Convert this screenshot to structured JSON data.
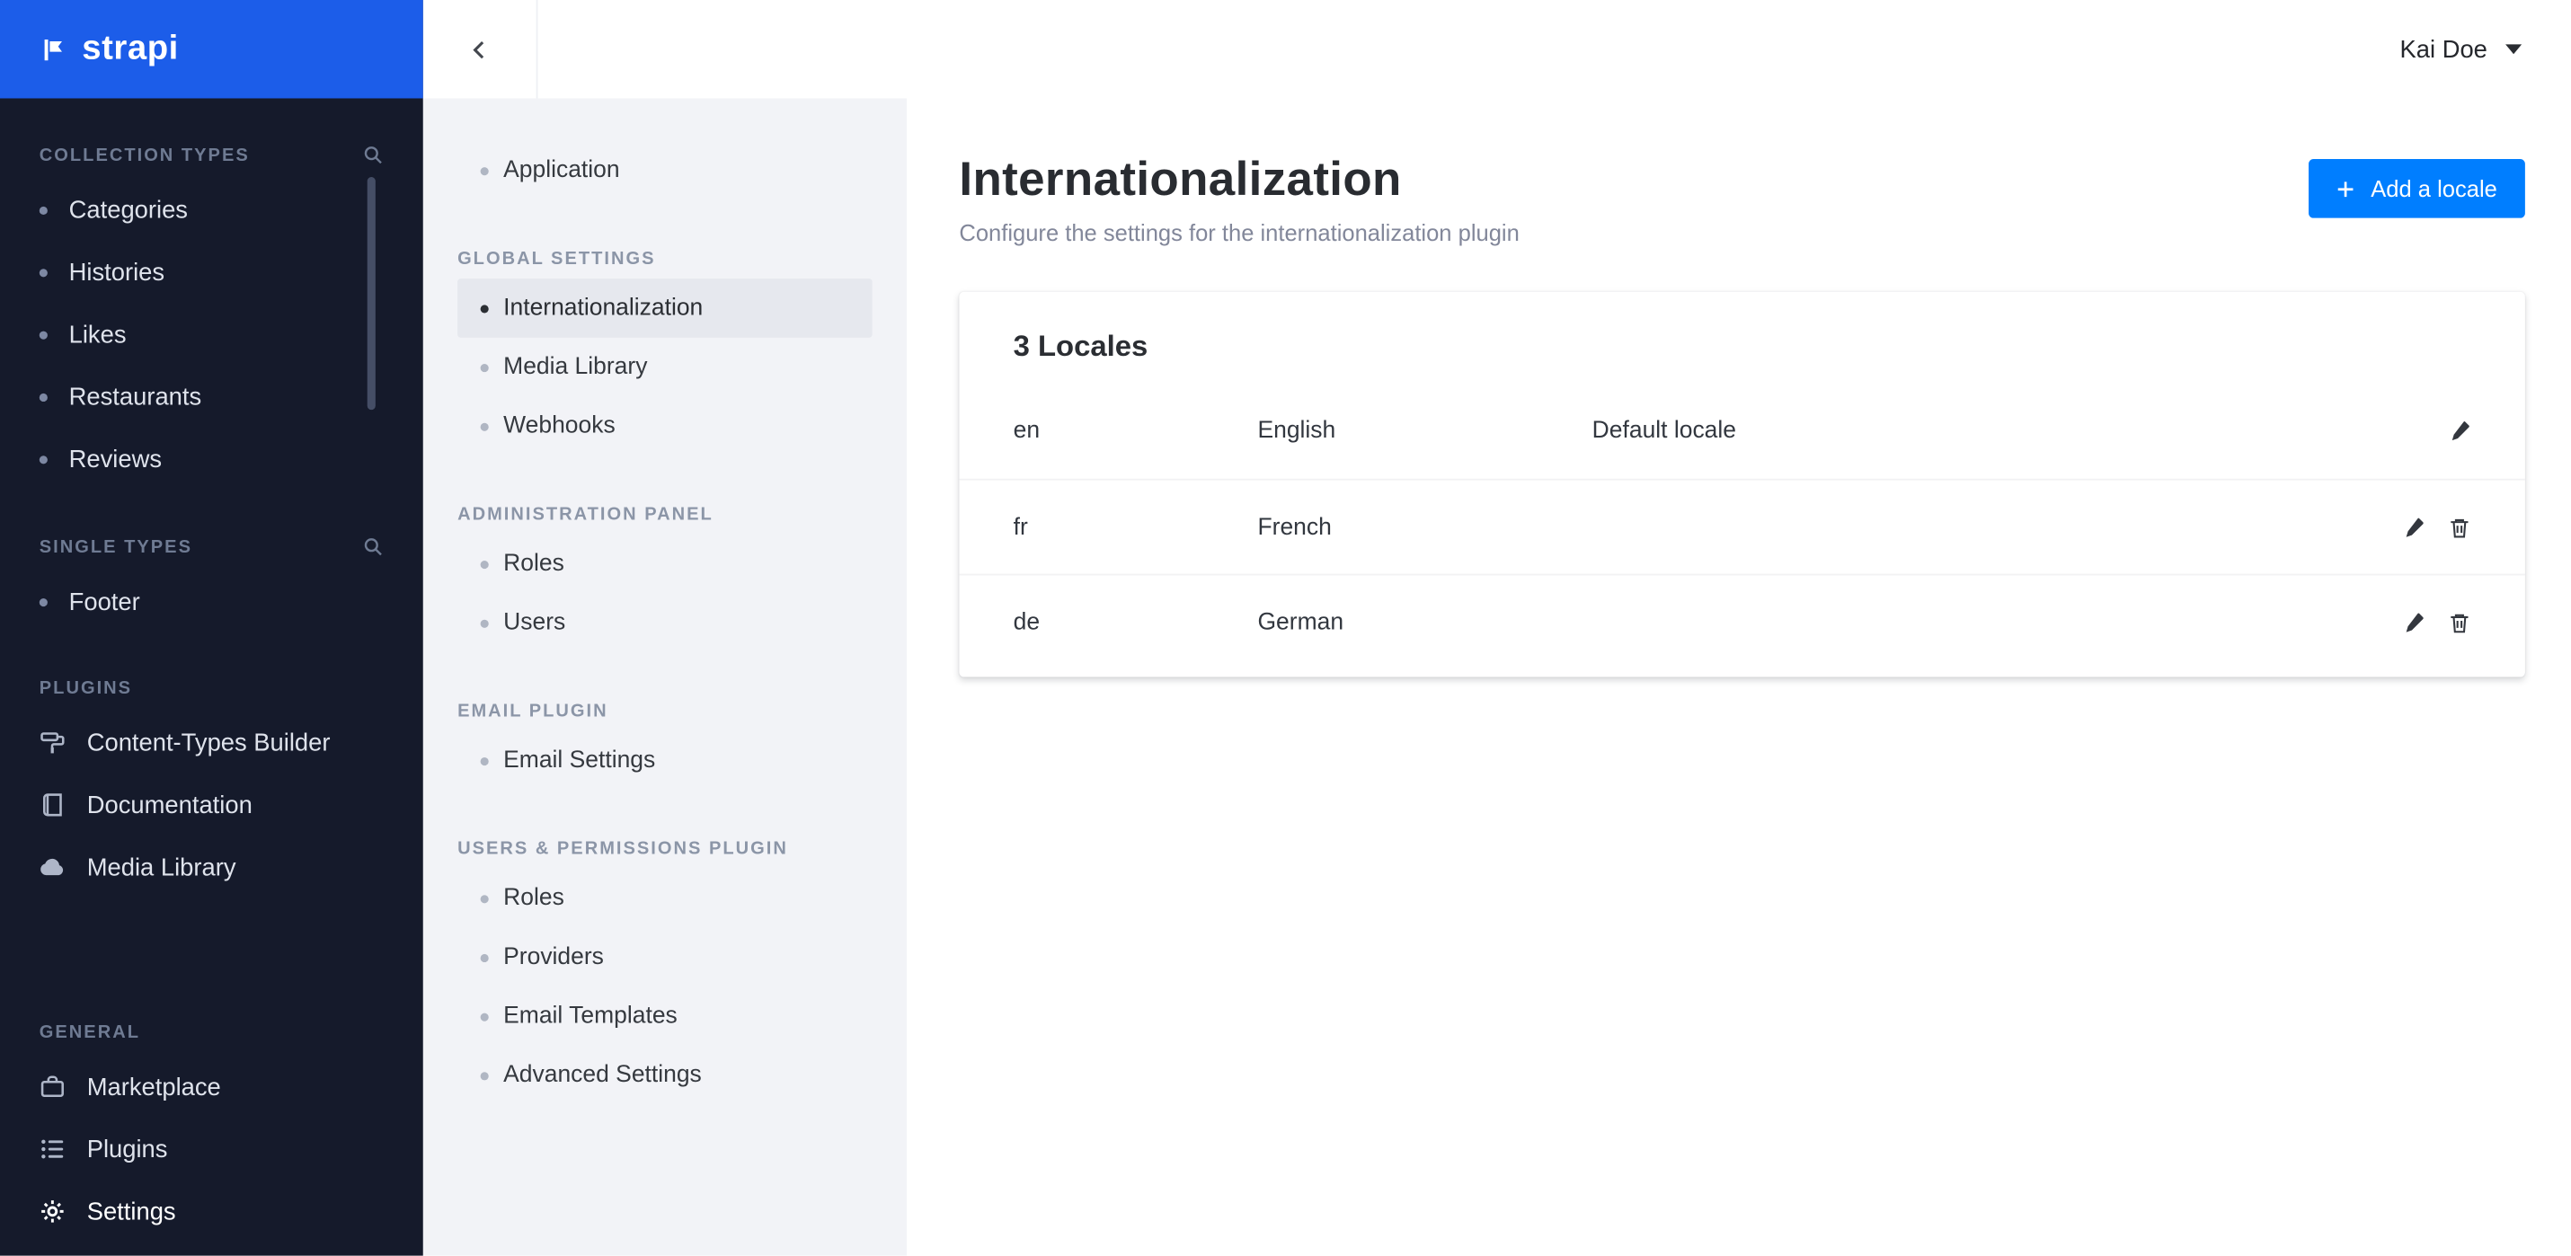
{
  "brand": {
    "name": "strapi"
  },
  "topbar": {
    "user_name": "Kai Doe"
  },
  "sidebar": {
    "collection_types": {
      "title": "COLLECTION TYPES",
      "items": [
        "Categories",
        "Histories",
        "Likes",
        "Restaurants",
        "Reviews"
      ]
    },
    "single_types": {
      "title": "SINGLE TYPES",
      "items": [
        "Footer"
      ]
    },
    "plugins_section": {
      "title": "PLUGINS",
      "items": [
        "Content-Types Builder",
        "Documentation",
        "Media Library"
      ]
    },
    "general_section": {
      "title": "GENERAL",
      "items": [
        "Marketplace",
        "Plugins",
        "Settings"
      ]
    }
  },
  "settings_nav": {
    "application": "Application",
    "global_settings": {
      "title": "GLOBAL SETTINGS",
      "items": [
        "Internationalization",
        "Media Library",
        "Webhooks"
      ]
    },
    "admin_panel": {
      "title": "ADMINISTRATION PANEL",
      "items": [
        "Roles",
        "Users"
      ]
    },
    "email_plugin": {
      "title": "EMAIL PLUGIN",
      "items": [
        "Email Settings"
      ]
    },
    "users_permissions": {
      "title": "USERS & PERMISSIONS PLUGIN",
      "items": [
        "Roles",
        "Providers",
        "Email Templates",
        "Advanced Settings"
      ]
    }
  },
  "page": {
    "title": "Internationalization",
    "subtitle": "Configure the settings for the internationalization plugin",
    "add_locale_button": "Add a locale"
  },
  "locales_card": {
    "title": "3 Locales",
    "rows": [
      {
        "code": "en",
        "name": "English",
        "note": "Default locale"
      },
      {
        "code": "fr",
        "name": "French",
        "note": ""
      },
      {
        "code": "de",
        "name": "German",
        "note": ""
      }
    ]
  },
  "colors": {
    "brand_blue": "#1c5de9",
    "primary_blue": "#007eff",
    "sidebar_bg": "#151a2b",
    "subnav_bg": "#f2f3f7"
  }
}
